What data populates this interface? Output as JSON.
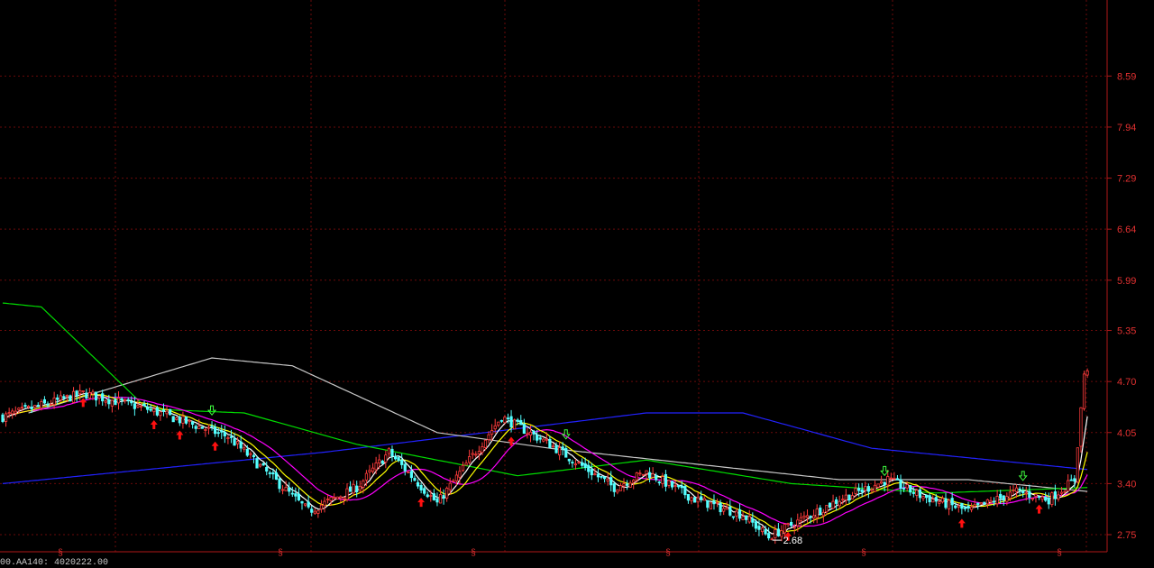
{
  "chart_data": {
    "type": "candlestick",
    "title": "",
    "xlabel": "",
    "ylabel": "",
    "ylim": [
      2.6,
      8.8
    ],
    "y_ticks": [
      "8.59",
      "7.94",
      "7.29",
      "6.64",
      "5.99",
      "5.35",
      "4.70",
      "4.05",
      "3.40",
      "2.75"
    ],
    "grid": true,
    "colors": {
      "up": "#ff3c3c",
      "down": "#54ffff",
      "axis": "#b01818",
      "grid": "#6a0a0a",
      "ma5": "#ffffff",
      "ma10": "#ffff00",
      "ma20": "#ff00ff",
      "ma60": "#00dd00",
      "ma120": "#c8c8c8",
      "ma250": "#2222ff"
    },
    "low_annotation": {
      "label": "2.68",
      "value": 2.68
    },
    "signal_markers": "§",
    "key_price_points": [
      {
        "bar": 0,
        "close": 4.25
      },
      {
        "bar": 25,
        "close": 4.55
      },
      {
        "bar": 45,
        "close": 4.35
      },
      {
        "bar": 70,
        "close": 4.0
      },
      {
        "bar": 95,
        "close": 3.05
      },
      {
        "bar": 110,
        "close": 3.35
      },
      {
        "bar": 120,
        "close": 3.8
      },
      {
        "bar": 135,
        "close": 3.15
      },
      {
        "bar": 155,
        "close": 4.25
      },
      {
        "bar": 170,
        "close": 3.9
      },
      {
        "bar": 190,
        "close": 3.35
      },
      {
        "bar": 200,
        "close": 3.55
      },
      {
        "bar": 215,
        "close": 3.2
      },
      {
        "bar": 230,
        "close": 3.0
      },
      {
        "bar": 238,
        "close": 2.72
      },
      {
        "bar": 260,
        "close": 3.2
      },
      {
        "bar": 275,
        "close": 3.45
      },
      {
        "bar": 285,
        "close": 3.25
      },
      {
        "bar": 300,
        "close": 3.05
      },
      {
        "bar": 315,
        "close": 3.3
      },
      {
        "bar": 325,
        "close": 3.2
      },
      {
        "bar": 333,
        "close": 3.45
      },
      {
        "bar": 336,
        "close": 4.8
      }
    ],
    "buy_signal_bars": [
      25,
      47,
      55,
      66,
      130,
      158,
      244,
      298,
      322
    ],
    "sell_signal_bars": [
      65,
      175,
      274,
      317
    ]
  },
  "footer": {
    "text": "00.AA140: 4020222.00"
  }
}
